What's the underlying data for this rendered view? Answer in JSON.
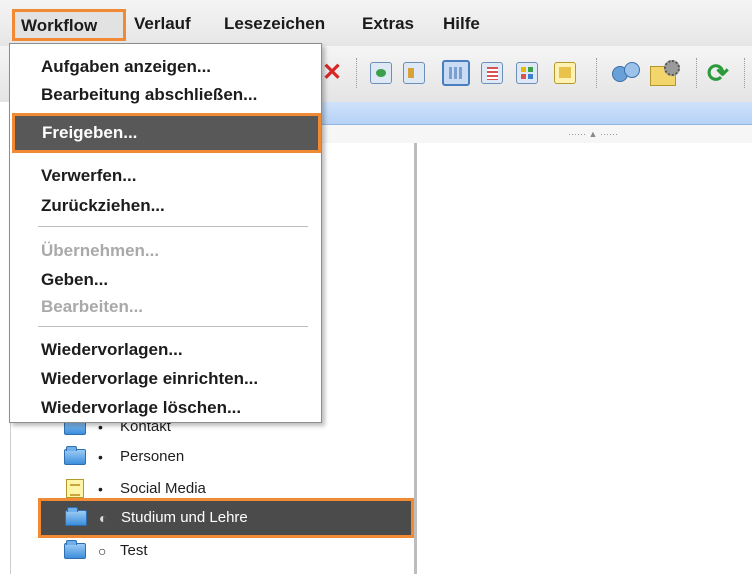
{
  "menubar": {
    "items": [
      "Workflow",
      "Verlauf",
      "Lesezeichen",
      "Extras",
      "Hilfe"
    ]
  },
  "toolbar": {
    "icons": [
      "stop-icon",
      "view-icon",
      "layout-icon",
      "grid-icon",
      "list-icon",
      "table-icon",
      "note-icon",
      "share-icon",
      "folder-config-icon",
      "refresh-icon"
    ]
  },
  "workflow_menu": {
    "items": [
      {
        "label": "Aufgaben anzeigen...",
        "enabled": true
      },
      {
        "label": "Bearbeitung abschließen...",
        "enabled": true
      },
      {
        "label": "Freigeben...",
        "enabled": true,
        "highlighted": true
      },
      {
        "label": "Verwerfen...",
        "enabled": true
      },
      {
        "label": "Zurückziehen...",
        "enabled": true
      },
      {
        "label": "Übernehmen...",
        "enabled": false
      },
      {
        "label": "Geben...",
        "enabled": true
      },
      {
        "label": "Bearbeiten...",
        "enabled": false
      },
      {
        "label": "Wiedervorlagen...",
        "enabled": true
      },
      {
        "label": "Wiedervorlage einrichten...",
        "enabled": true
      },
      {
        "label": "Wiedervorlage löschen...",
        "enabled": true
      }
    ]
  },
  "tree": {
    "items": [
      {
        "label": "Kontakt",
        "icon": "folder-icon",
        "bullet": "•"
      },
      {
        "label": "Personen",
        "icon": "folder-icon",
        "bullet": "•"
      },
      {
        "label": "Social Media",
        "icon": "document-icon",
        "bullet": "•"
      },
      {
        "label": "Studium und Lehre",
        "icon": "folder-icon",
        "bullet": "◐",
        "selected": true
      },
      {
        "label": "Test",
        "icon": "folder-icon",
        "bullet": "○"
      }
    ]
  },
  "colors": {
    "highlight_border": "#f08a35",
    "selection_background": "#4b4b4b",
    "header_blue": "#b6d2f5"
  }
}
